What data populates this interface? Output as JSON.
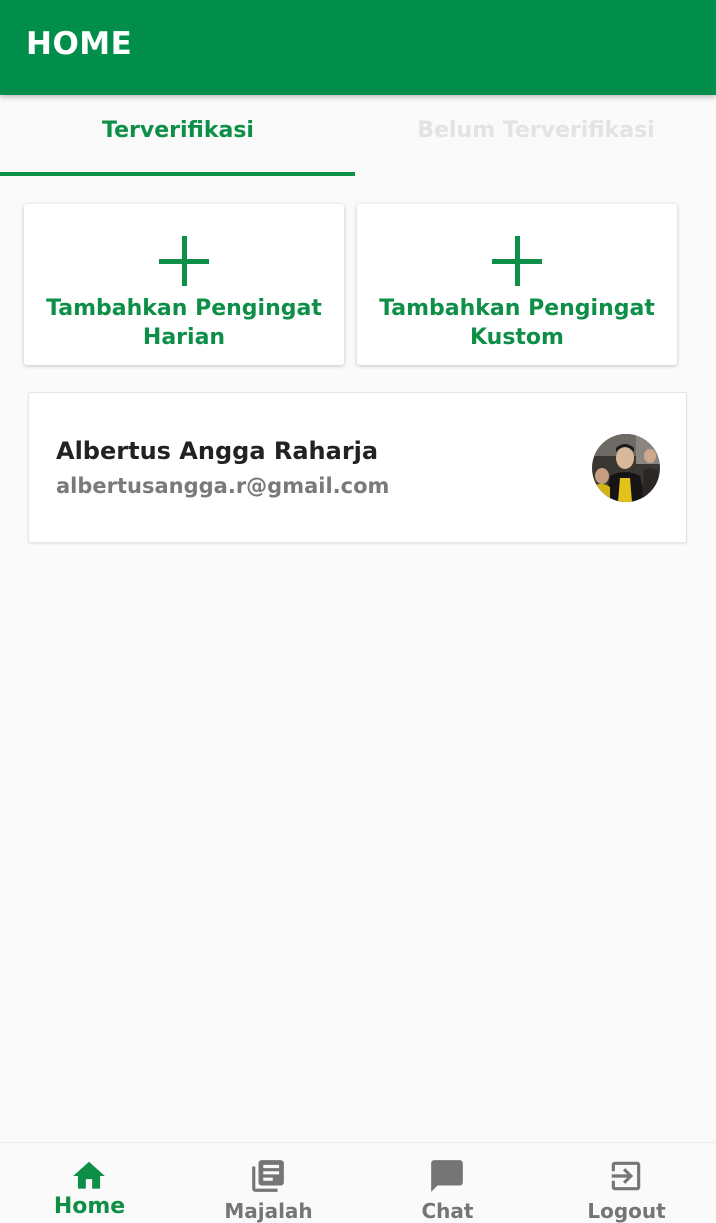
{
  "app_bar": {
    "title": "HOME"
  },
  "tabs": [
    {
      "label": "Terverifikasi",
      "active": true
    },
    {
      "label": "Belum Terverifikasi",
      "active": false
    }
  ],
  "actions": {
    "daily": {
      "line1": "Tambahkan Pengingat",
      "line2": "Harian",
      "icon": "plus-icon"
    },
    "custom": {
      "line1": "Tambahkan Pengingat",
      "line2": "Kustom",
      "icon": "plus-icon"
    }
  },
  "profile": {
    "name": "Albertus Angga Raharja",
    "email": "albertusangga.r@gmail.com"
  },
  "bottom_nav": [
    {
      "label": "Home",
      "icon": "home-icon",
      "active": true
    },
    {
      "label": "Majalah",
      "icon": "magazine-icon",
      "active": false
    },
    {
      "label": "Chat",
      "icon": "chat-icon",
      "active": false
    },
    {
      "label": "Logout",
      "icon": "logout-icon",
      "active": false
    }
  ],
  "colors": {
    "primary": "#008e4a",
    "accent_text": "#0e8f48",
    "inactive_tab": "#e3e3e3",
    "nav_inactive": "#757575"
  }
}
